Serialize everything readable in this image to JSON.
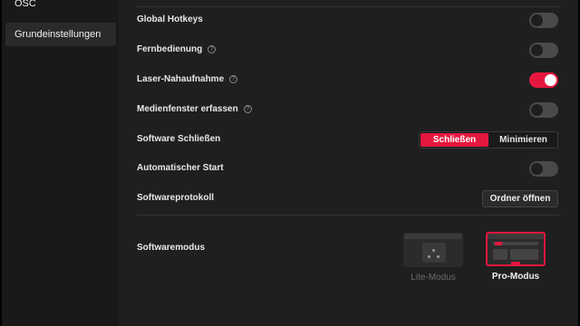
{
  "sidebar": {
    "items": [
      {
        "label": "OSC",
        "active": false
      },
      {
        "label": "Grundeinstellungen",
        "active": true
      }
    ]
  },
  "settings": {
    "global_hotkeys": {
      "label": "Global Hotkeys",
      "enabled": false
    },
    "remote": {
      "label": "Fernbedienung",
      "help": "?",
      "enabled": false
    },
    "laser": {
      "label": "Laser-Nahaufnahme",
      "help": "?",
      "enabled": true
    },
    "media_capture": {
      "label": "Medienfenster erfassen",
      "help": "?",
      "enabled": false
    },
    "close_software": {
      "label": "Software Schließen",
      "options": [
        "Schließen",
        "Minimieren"
      ],
      "selected": "Schließen"
    },
    "autostart": {
      "label": "Automatischer Start",
      "enabled": false
    },
    "log": {
      "label": "Softwareprotokoll",
      "button": "Ordner öffnen"
    },
    "mode": {
      "label": "Softwaremodus",
      "options": [
        {
          "label": "Lite-Modus",
          "selected": false
        },
        {
          "label": "Pro-Modus",
          "selected": true
        }
      ]
    }
  },
  "colors": {
    "accent": "#e5173f",
    "background": "#1f1f1f",
    "sidebar": "#191919"
  }
}
